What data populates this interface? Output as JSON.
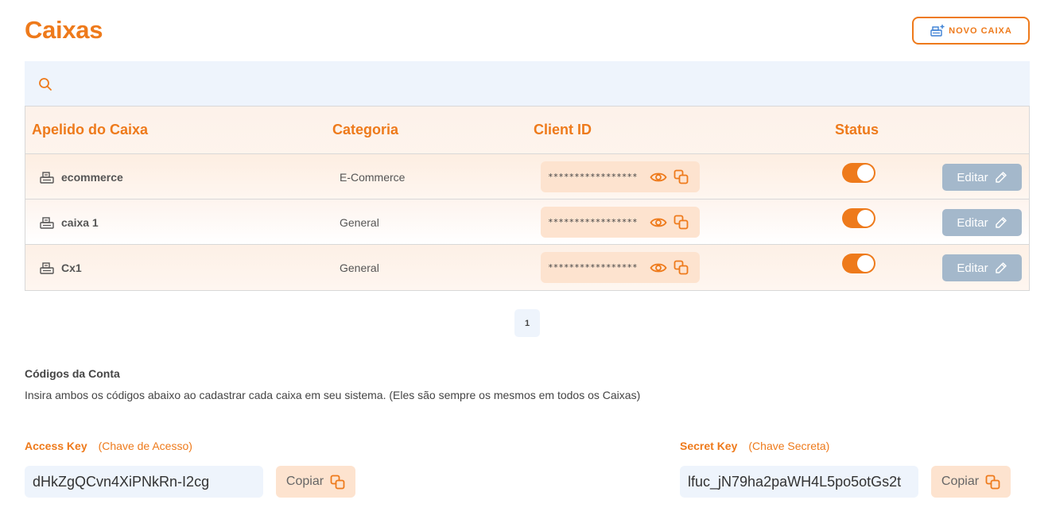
{
  "page": {
    "title": "Caixas"
  },
  "toolbar": {
    "new_label": "NOVO CAIXA"
  },
  "search": {
    "placeholder": ""
  },
  "table": {
    "headers": {
      "name": "Apelido do Caixa",
      "category": "Categoria",
      "client_id": "Client ID",
      "status": "Status"
    },
    "rows": [
      {
        "name": "ecommerce",
        "category": "E-Commerce",
        "client_id_masked": "*****************",
        "status_on": true,
        "edit_label": "Editar"
      },
      {
        "name": "caixa 1",
        "category": "General",
        "client_id_masked": "*****************",
        "status_on": true,
        "edit_label": "Editar"
      },
      {
        "name": "Cx1",
        "category": "General",
        "client_id_masked": "*****************",
        "status_on": true,
        "edit_label": "Editar"
      }
    ]
  },
  "pagination": {
    "current": "1"
  },
  "codes": {
    "title": "Códigos da Conta",
    "description": "Insira ambos os códigos abaixo ao cadastrar cada caixa em seu sistema. (Eles são sempre os mesmos em todos os Caixas)",
    "access_key": {
      "label": "Access Key",
      "sublabel": "(Chave de Acesso)",
      "value": "dHkZgQCvn4XiPNkRn-I2cg",
      "copy_label": "Copiar"
    },
    "secret_key": {
      "label": "Secret Key",
      "sublabel": "(Chave Secreta)",
      "value": "lfuc_jN79ha2paWH4L5po5otGs2t",
      "copy_label": "Copiar"
    }
  },
  "colors": {
    "accent": "#ee7a1b",
    "edit_button": "#a4b8cb",
    "field_bg": "#eef4fc",
    "chip_bg": "#fde3cf"
  }
}
